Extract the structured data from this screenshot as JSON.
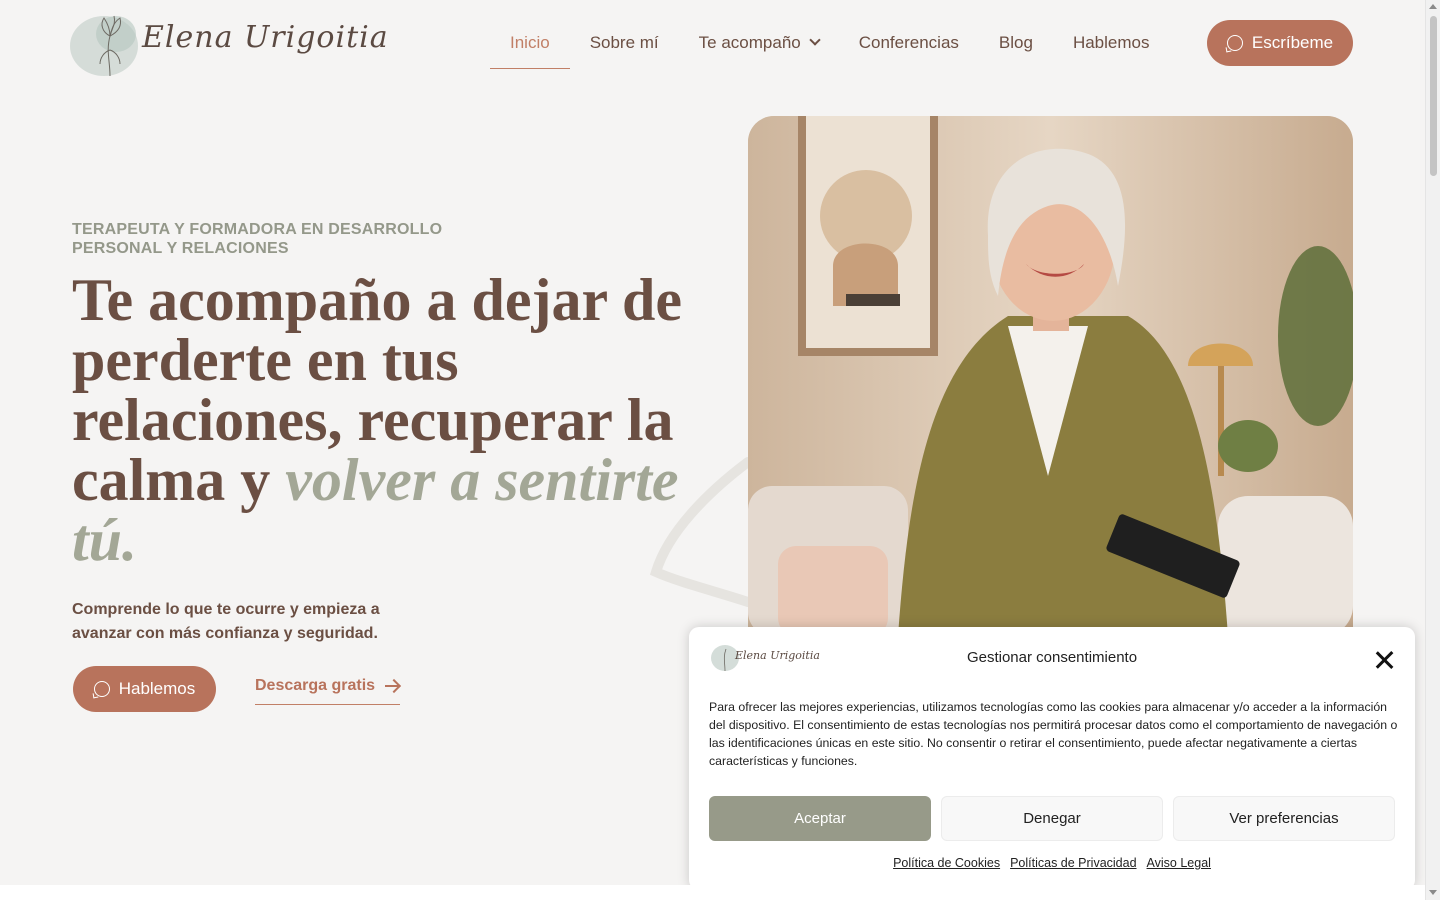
{
  "header": {
    "logo_text": "Elena Urigoitia",
    "nav": [
      {
        "label": "Inicio",
        "active": true
      },
      {
        "label": "Sobre mí"
      },
      {
        "label": "Te acompaño",
        "has_dropdown": true
      },
      {
        "label": "Conferencias"
      },
      {
        "label": "Blog"
      },
      {
        "label": "Hablemos"
      }
    ],
    "cta_label": "Escríbeme",
    "cta_icon": "whatsapp-icon"
  },
  "hero": {
    "eyebrow": "TERAPEUTA Y FORMADORA EN DESARROLLO PERSONAL Y RELACIONES",
    "headline_plain": "Te acompaño a dejar de perderte en tus relaciones, recuperar la calma y ",
    "headline_accent": "volver a sentirte tú.",
    "subtitle": "Comprende lo que te ocurre y empieza a avanzar con más confianza y seguridad.",
    "primary_button": "Hablemos",
    "secondary_link": "Descarga gratis"
  },
  "cookie_modal": {
    "logo_text": "Elena Urigoitia",
    "title": "Gestionar consentimiento",
    "body": "Para ofrecer las mejores experiencias, utilizamos tecnologías como las cookies para almacenar y/o acceder a la información del dispositivo. El consentimiento de estas tecnologías nos permitirá procesar datos como el comportamiento de navegación o las identificaciones únicas en este sitio. No consentir o retirar el consentimiento, puede afectar negativamente a ciertas características y funciones.",
    "accept": "Aceptar",
    "deny": "Denegar",
    "preferences": "Ver preferencias",
    "links": [
      "Política de Cookies",
      "Políticas de Privacidad",
      "Aviso Legal"
    ]
  },
  "colors": {
    "brand": "#b8735c",
    "text": "#6b4f43",
    "accent_sage": "#a3a796",
    "background": "#f5f4f3"
  }
}
